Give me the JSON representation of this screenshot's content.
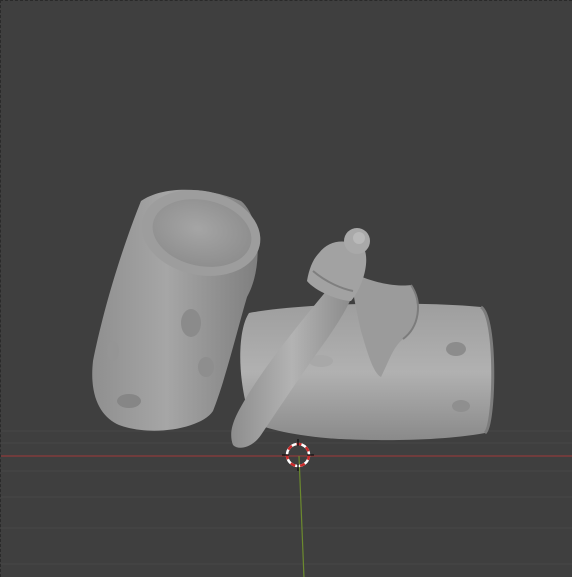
{
  "viewport": {
    "kind": "3d-viewport",
    "background": "#3f3f3f",
    "grid_color": "#474747",
    "x_axis_color": "#8e3b3b",
    "y_axis_color": "#6c8a2e",
    "cursor_colors": [
      "#cc2b2b",
      "#ffffff"
    ]
  },
  "scene": {
    "objects": [
      {
        "name": "stump-upright"
      },
      {
        "name": "log-lying"
      },
      {
        "name": "axe"
      }
    ],
    "mesh_color": "#9a9a9a"
  },
  "cursor": {
    "icon": "3d-cursor-icon"
  }
}
